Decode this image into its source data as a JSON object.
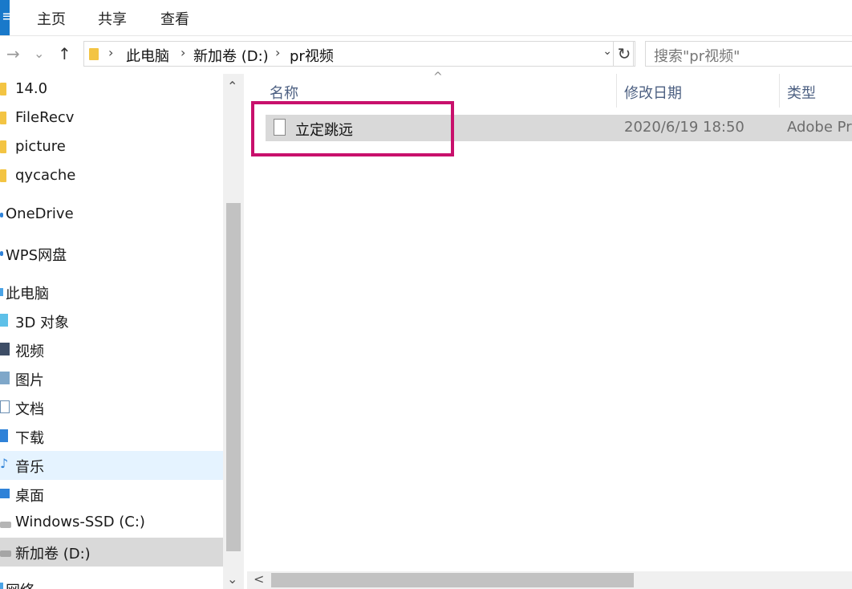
{
  "ribbon": {
    "file_tab": "≡",
    "tabs": [
      "主页",
      "共享",
      "查看"
    ]
  },
  "nav": {
    "back": "→",
    "history": "⌄",
    "up": "↑"
  },
  "address": {
    "crumbs": [
      "此电脑",
      "新加卷 (D:)",
      "pr视频"
    ],
    "separator": "›",
    "dropdown": "⌄",
    "refresh": "↻"
  },
  "search": {
    "placeholder": "搜索\"pr视频\""
  },
  "sidebar": {
    "items": [
      {
        "label": "14.0",
        "icon": "folder-icon"
      },
      {
        "label": "FileRecv",
        "icon": "folder-icon"
      },
      {
        "label": "picture",
        "icon": "folder-icon"
      },
      {
        "label": "qycache",
        "icon": "folder-icon"
      },
      {
        "label": "OneDrive",
        "icon": "cloud-icon"
      },
      {
        "label": "WPS网盘",
        "icon": "cloud-icon"
      },
      {
        "label": "此电脑",
        "icon": "computer-icon"
      },
      {
        "label": "3D 对象",
        "icon": "cube-icon"
      },
      {
        "label": "视频",
        "icon": "video-icon"
      },
      {
        "label": "图片",
        "icon": "picture-icon"
      },
      {
        "label": "文档",
        "icon": "document-icon"
      },
      {
        "label": "下载",
        "icon": "download-icon"
      },
      {
        "label": "音乐",
        "icon": "music-icon"
      },
      {
        "label": "桌面",
        "icon": "desktop-icon"
      },
      {
        "label": "Windows-SSD (C:)",
        "icon": "drive-icon"
      },
      {
        "label": "新加卷 (D:)",
        "icon": "drive-icon"
      },
      {
        "label": "网络",
        "icon": "network-icon"
      }
    ],
    "scroll_up": "⌃",
    "scroll_down": "⌄"
  },
  "columns": {
    "name": "名称",
    "date": "修改日期",
    "type": "类型",
    "sort_indicator": "^"
  },
  "files": [
    {
      "name": "立定跳远",
      "date": "2020/6/19 18:50",
      "type": "Adobe Pr"
    }
  ],
  "hscroll_left": "<",
  "colors": {
    "highlight": "#c8106c",
    "selection": "#d9d9d9",
    "hover": "#e5f3ff",
    "file_tab": "#1979ca"
  }
}
